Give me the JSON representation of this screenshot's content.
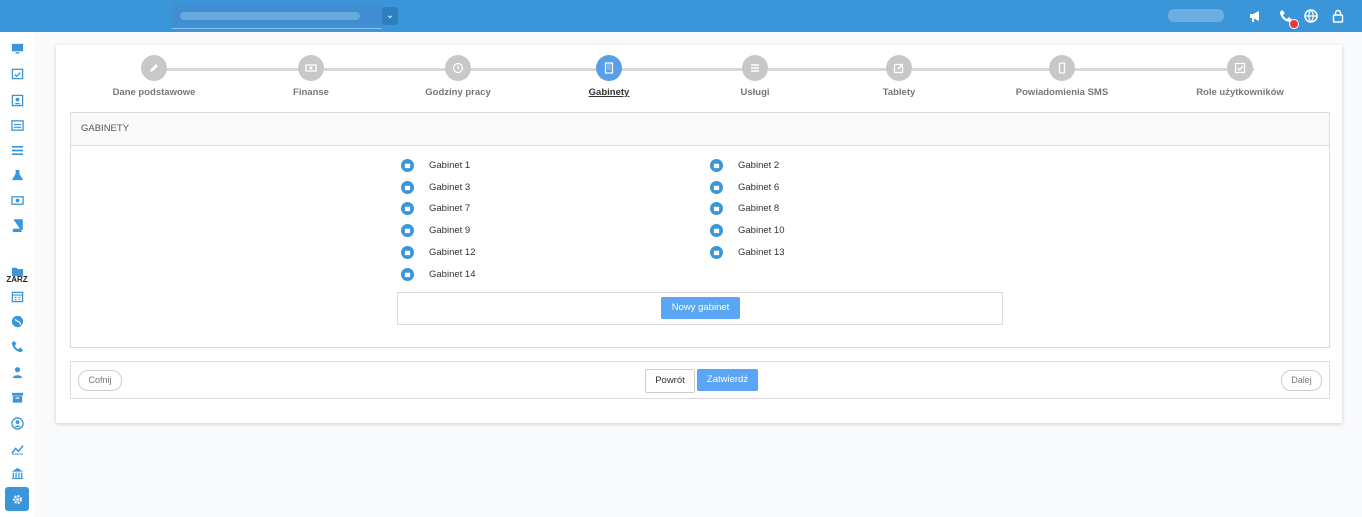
{
  "steps": [
    {
      "label": "Dane podstawowe",
      "icon": "pencil-icon"
    },
    {
      "label": "Finanse",
      "icon": "money-icon"
    },
    {
      "label": "Godziny pracy",
      "icon": "clock-icon"
    },
    {
      "label": "Gabinety",
      "icon": "building-icon"
    },
    {
      "label": "Usługi",
      "icon": "list-icon"
    },
    {
      "label": "Tablety",
      "icon": "edit-icon"
    },
    {
      "label": "Powiadomienia SMS",
      "icon": "phone-icon"
    },
    {
      "label": "Role użytkowników",
      "icon": "check-icon"
    }
  ],
  "active_step": "Gabinety",
  "panel": {
    "title": "GABINETY"
  },
  "rooms_left": [
    "Gabinet 1",
    "Gabinet 3",
    "Gabinet 7",
    "Gabinet 9",
    "Gabinet 12",
    "Gabinet 14"
  ],
  "rooms_right": [
    "Gabinet 2",
    "Gabinet 6",
    "Gabinet 8",
    "Gabinet 10",
    "Gabinet 13"
  ],
  "buttons": {
    "new_room": "Nowy gabinet",
    "undo": "Cofnij",
    "back": "Powrót",
    "confirm": "Zatwierdź",
    "next": "Dalej"
  },
  "sidebar": {
    "section_label": "ZARZ"
  },
  "colors": {
    "accent": "#3a96d9",
    "button": "#5aa6f5",
    "inactive_step": "#c8c8c8"
  }
}
